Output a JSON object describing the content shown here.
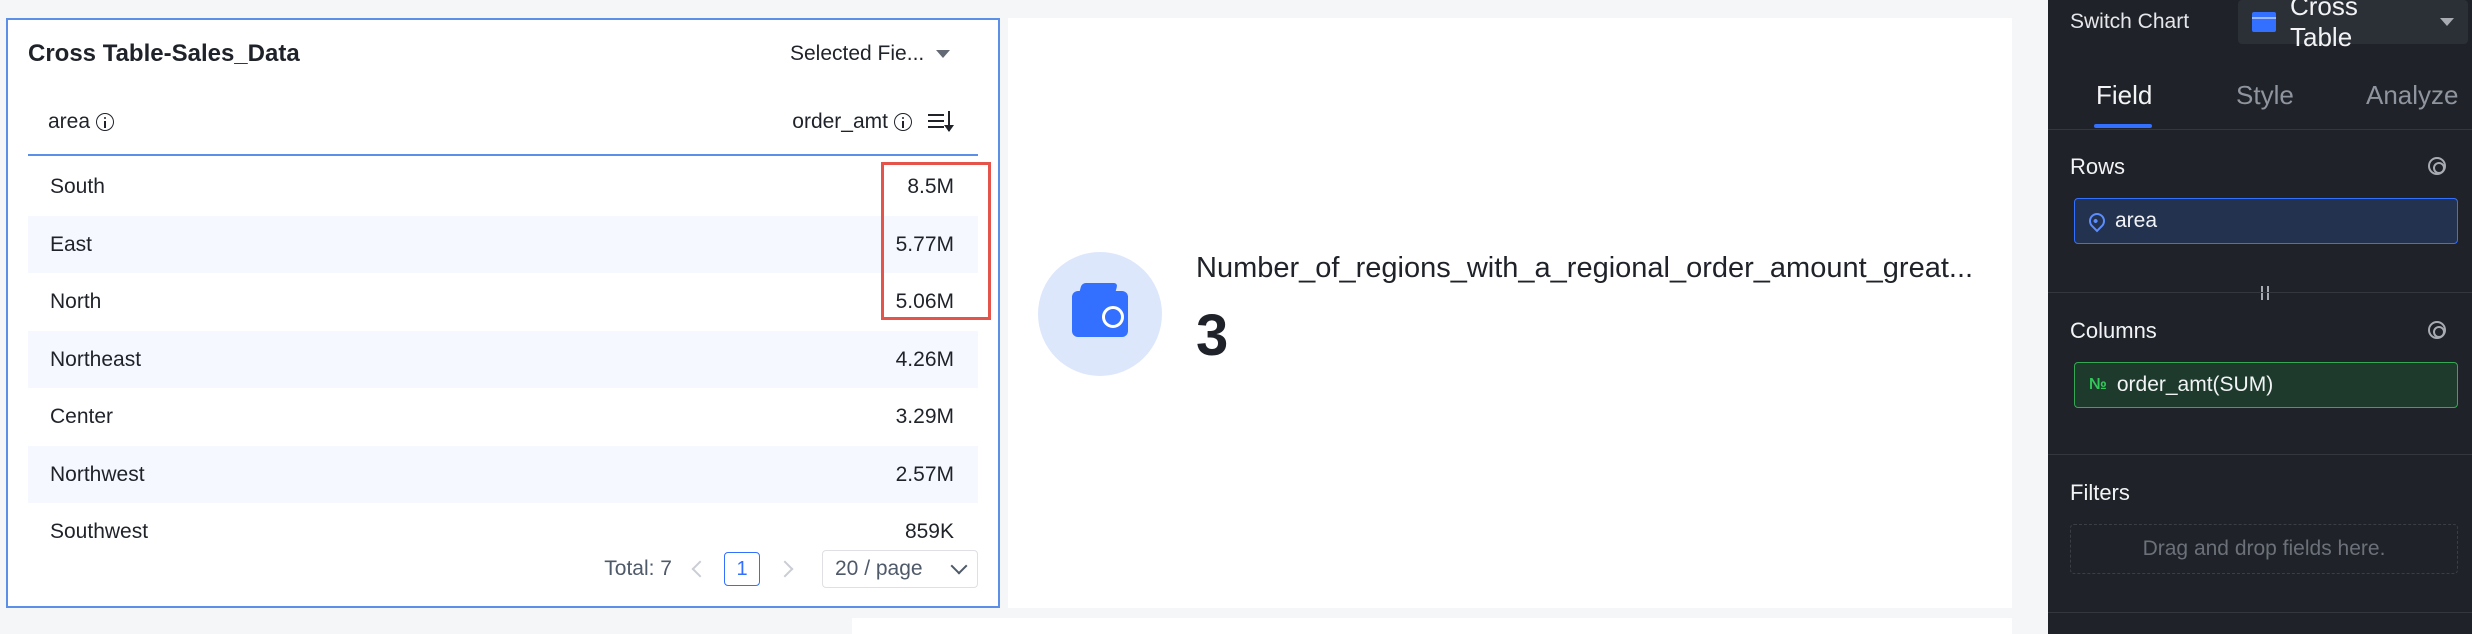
{
  "table_card": {
    "title": "Cross Table-Sales_Data",
    "selected_fields_label": "Selected Fie...",
    "columns": [
      "area",
      "order_amt"
    ],
    "rows": [
      {
        "area": "South",
        "order_amt": "8.5M"
      },
      {
        "area": "East",
        "order_amt": "5.77M"
      },
      {
        "area": "North",
        "order_amt": "5.06M"
      },
      {
        "area": "Northeast",
        "order_amt": "4.26M"
      },
      {
        "area": "Center",
        "order_amt": "3.29M"
      },
      {
        "area": "Northwest",
        "order_amt": "2.57M"
      },
      {
        "area": "Southwest",
        "order_amt": "859K"
      }
    ],
    "pagination": {
      "total_label": "Total: 7",
      "current_page": "1",
      "page_size": "20 / page"
    }
  },
  "kpi_card": {
    "label": "Number_of_regions_with_a_regional_order_amount_great...",
    "value": "3",
    "icon": "wallet-icon"
  },
  "panel": {
    "switch_chart_label": "Switch Chart",
    "chart_type": "Cross Table",
    "tabs": [
      "Field",
      "Style",
      "Analyze"
    ],
    "active_tab": "Field",
    "rows_label": "Rows",
    "rows_field": "area",
    "columns_label": "Columns",
    "columns_field": "order_amt(SUM)",
    "columns_field_icon": "№",
    "filters_label": "Filters",
    "filters_placeholder": "Drag and drop fields here."
  },
  "colors": {
    "accent": "#3370ff",
    "highlight": "#e4544b",
    "panel_bg": "#1f2228",
    "measure_green": "#34a853"
  }
}
